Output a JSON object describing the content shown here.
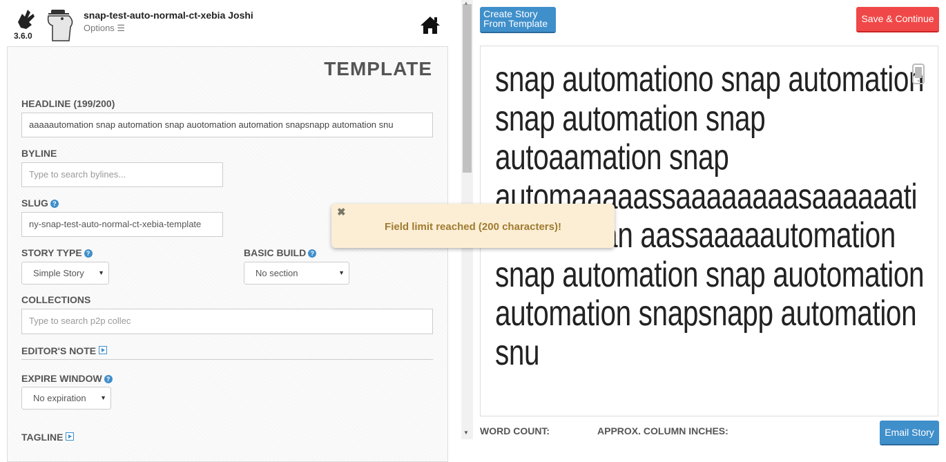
{
  "header": {
    "version": "3.6.0",
    "story_title": "snap-test-auto-normal-ct-xebia Joshi",
    "options_label": "Options ☰"
  },
  "template": {
    "heading": "TEMPLATE",
    "headline_label": "HEADLINE (199/200)",
    "headline_value": "aaaaautomation snap automation snap auotomation automation snapsnapp automation snu",
    "byline_label": "BYLINE",
    "byline_placeholder": "Type to search bylines...",
    "slug_label": "SLUG",
    "slug_value": "ny-snap-test-auto-normal-ct-xebia-template",
    "story_type_label": "STORY TYPE",
    "story_type_value": "Simple Story",
    "basic_build_label": "BASIC BUILD",
    "basic_build_value": "No section",
    "collections_label": "COLLECTIONS",
    "collections_placeholder": "Type to search p2p collec",
    "editors_note_label": "EDITOR'S NOTE",
    "expire_window_label": "EXPIRE WINDOW",
    "expire_window_value": "No expiration",
    "tagline_label": "TAGLINE"
  },
  "actions": {
    "create_from_template": "Create Story\nFrom Template",
    "save_continue": "Save & Continue",
    "email_story": "Email Story"
  },
  "preview": {
    "headline": "snap automationo snap automation snap automation snap autoaamation snap automaaaaassaaaaaaaasaaaaaati ooaaaaaan aassaaaaautomation snap automation snap auotomation automation snapsnapp automation snu"
  },
  "stats": {
    "word_count_label": "WORD COUNT:",
    "column_inches_label": "APPROX. COLUMN INCHES:"
  },
  "toast": {
    "message": "Field limit reached (200 characters)!",
    "close": "✖"
  },
  "colors": {
    "accent_blue": "#3f8fcb",
    "save_red": "#f04848",
    "toast_bg": "#fbeed5",
    "toast_text": "#a07a30"
  }
}
